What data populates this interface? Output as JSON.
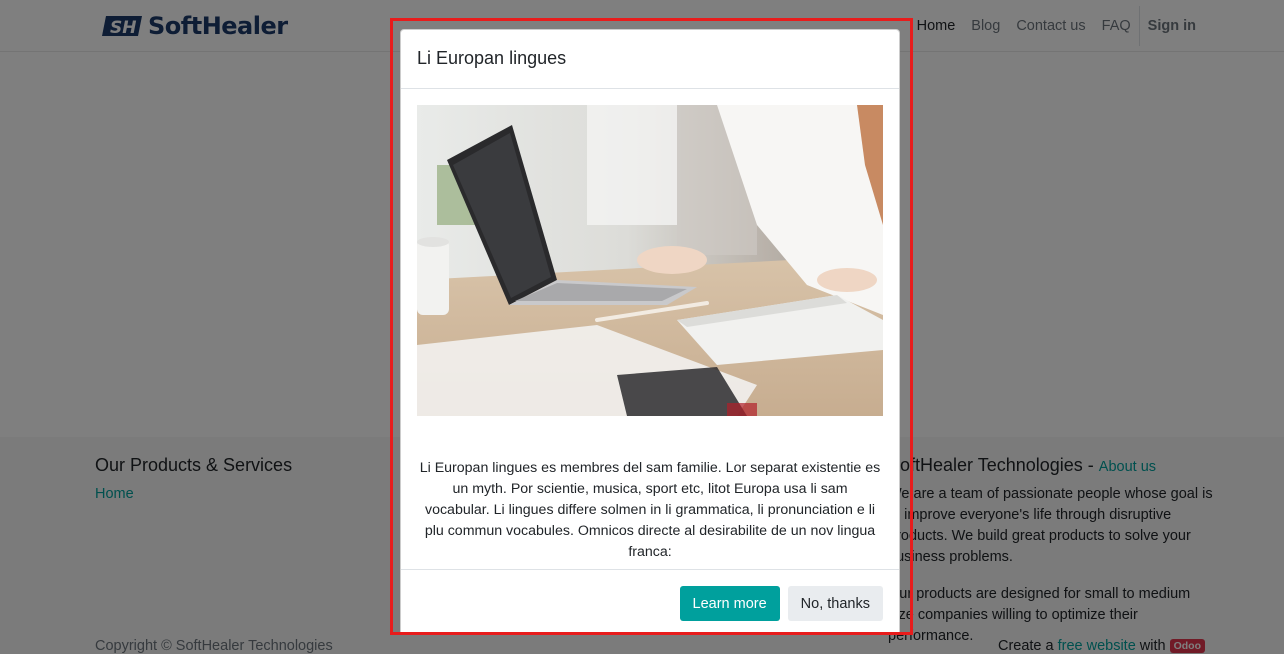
{
  "brand": {
    "name": "SoftHealer",
    "logo_mark": "SH"
  },
  "nav": {
    "items": [
      {
        "label": "Home",
        "active": true
      },
      {
        "label": "Blog",
        "active": false
      },
      {
        "label": "Contact us",
        "active": false
      },
      {
        "label": "FAQ",
        "active": false
      }
    ],
    "signin": "Sign in"
  },
  "footer": {
    "col1": {
      "heading": "Our Products & Services",
      "links": [
        "Home"
      ]
    },
    "col2": {
      "heading_name": "SoftHealer Technologies",
      "heading_sep": " - ",
      "about_link": "About us",
      "para1": "We are a team of passionate people whose goal is to improve everyone's life through disruptive products. We build great products to solve your business problems.",
      "para2": "Our products are designed for small to medium size companies willing to optimize their performance."
    },
    "copyright": "Copyright © SoftHealer Technologies",
    "powered": {
      "prefix": "Create a",
      "link": "free website",
      "with": "with",
      "badge": "Odoo"
    }
  },
  "modal": {
    "title": "Li Europan lingues",
    "image_icon": "laptop-desk-photo",
    "body_text": "Li Europan lingues es membres del sam familie. Lor separat existentie es un myth. Por scientie, musica, sport etc, litot Europa usa li sam vocabular. Li lingues differe solmen in li grammatica, li pronunciation e li plu commun vocabules. Omnicos directe al desirabilite de un nov lingua franca:",
    "primary_button": "Learn more",
    "secondary_button": "No, thanks"
  },
  "colors": {
    "accent": "#00a09d",
    "highlight_border": "#e81c1c",
    "brand_blue": "#1c3a6b",
    "odoo_badge": "#e3374f"
  }
}
